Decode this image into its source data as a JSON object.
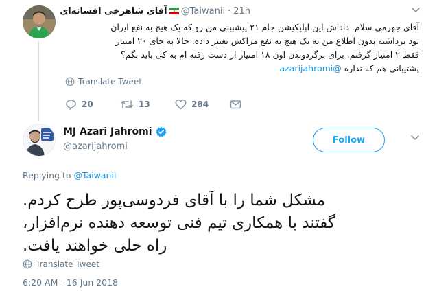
{
  "parent_tweet": {
    "author_name": "آقای شاهرخی افسانه‌ای",
    "handle": "@Taiwanii",
    "time": "21h",
    "text_lines": [
      "آقای جهرمی سلام. داداش این اپلیکیشن جام ۲۱ پیشبینی من رو که یک هیچ به نفع ایران",
      "بود برداشته بدون اطلاع من به یک هیچ به نفع مراکش تغییر داده. حالا به جای ۲۰ امتیاز",
      "فقط ۲ امتیاز گرفتم. برای برگردوندن اون ۱۸ امتیاز از دست رفته ام به کی باید بگم؟",
      "پشتیبانی هم که نداره"
    ],
    "mention": "@azarijahromi",
    "translate_label": "Translate Tweet",
    "reply_count": "20",
    "retweet_count": "13",
    "like_count": "284"
  },
  "main_tweet": {
    "author_name": "MJ Azari Jahromi",
    "handle": "@azarijahromi",
    "follow_label": "Follow",
    "replying_prefix": "Replying to",
    "replying_to": "@Taiwanii",
    "text_lines": [
      "مشکل شما را با آقای فردوسی‌پور طرح کردم.",
      "گفتند با همکاری تیم فنی توسعه دهنده نرم‌افزار،",
      "راه حلی خواهند یافت."
    ],
    "translate_label": "Translate Tweet",
    "timestamp": "6:20 AM - 16 Jun 2018"
  },
  "colors": {
    "accent": "#1da1f2",
    "link": "#1b95e0",
    "secondary_text": "#657786"
  }
}
